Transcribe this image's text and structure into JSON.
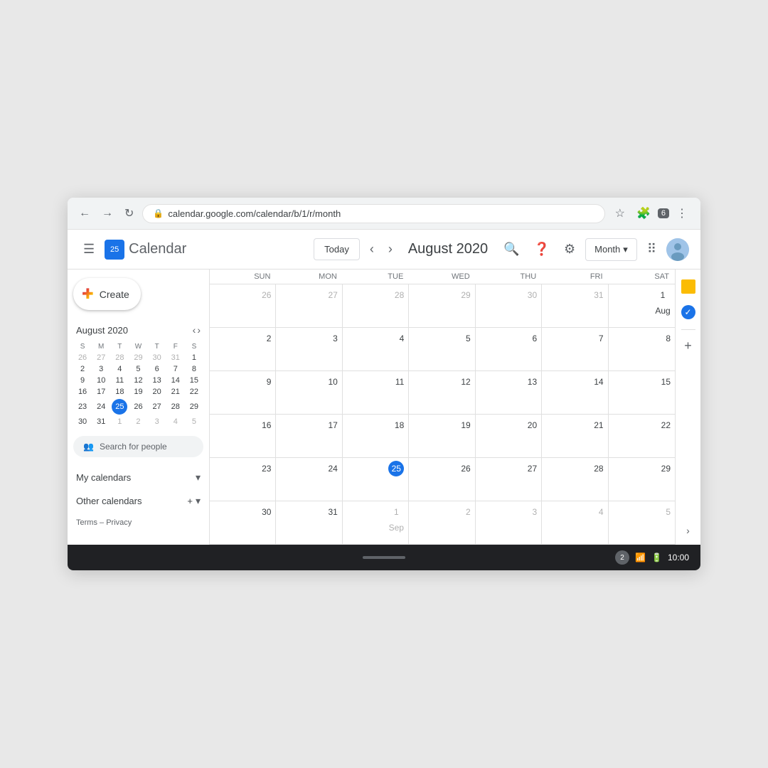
{
  "browser": {
    "url": "calendar.google.com/calendar/b/1/r/month",
    "tab_count": "6"
  },
  "header": {
    "logo_date": "25",
    "logo_text": "Calendar",
    "today_btn": "Today",
    "month_title": "August 2020",
    "view_label": "Month"
  },
  "sidebar": {
    "create_label": "Create",
    "mini_cal_title": "August 2020",
    "mini_cal_days": [
      "S",
      "M",
      "T",
      "W",
      "T",
      "F",
      "S"
    ],
    "mini_cal_rows": [
      [
        "26",
        "27",
        "28",
        "29",
        "30",
        "31",
        "1"
      ],
      [
        "2",
        "3",
        "4",
        "5",
        "6",
        "7",
        "8"
      ],
      [
        "9",
        "10",
        "11",
        "12",
        "13",
        "14",
        "15"
      ],
      [
        "16",
        "17",
        "18",
        "19",
        "20",
        "21",
        "22"
      ],
      [
        "23",
        "24",
        "25",
        "26",
        "27",
        "28",
        "29"
      ],
      [
        "30",
        "31",
        "1",
        "2",
        "3",
        "4",
        "5"
      ]
    ],
    "today_mini": "25",
    "search_people_placeholder": "Search for people",
    "my_calendars_label": "My calendars",
    "other_calendars_label": "Other calendars",
    "terms_label": "Terms",
    "privacy_label": "Privacy"
  },
  "calendar": {
    "weekdays": [
      "SUN",
      "MON",
      "TUE",
      "WED",
      "THU",
      "FRI",
      "SAT"
    ],
    "rows": [
      [
        {
          "day": "26",
          "type": "prev"
        },
        {
          "day": "27",
          "type": "prev"
        },
        {
          "day": "28",
          "type": "prev"
        },
        {
          "day": "29",
          "type": "prev"
        },
        {
          "day": "30",
          "type": "prev"
        },
        {
          "day": "31",
          "type": "prev"
        },
        {
          "day": "1 Aug",
          "type": "first"
        }
      ],
      [
        {
          "day": "2",
          "type": "cur"
        },
        {
          "day": "3",
          "type": "cur"
        },
        {
          "day": "4",
          "type": "cur"
        },
        {
          "day": "5",
          "type": "cur"
        },
        {
          "day": "6",
          "type": "cur"
        },
        {
          "day": "7",
          "type": "cur"
        },
        {
          "day": "8",
          "type": "cur"
        }
      ],
      [
        {
          "day": "9",
          "type": "cur"
        },
        {
          "day": "10",
          "type": "cur"
        },
        {
          "day": "11",
          "type": "cur"
        },
        {
          "day": "12",
          "type": "cur"
        },
        {
          "day": "13",
          "type": "cur"
        },
        {
          "day": "14",
          "type": "cur"
        },
        {
          "day": "15",
          "type": "cur"
        }
      ],
      [
        {
          "day": "16",
          "type": "cur"
        },
        {
          "day": "17",
          "type": "cur"
        },
        {
          "day": "18",
          "type": "cur"
        },
        {
          "day": "19",
          "type": "cur"
        },
        {
          "day": "20",
          "type": "cur"
        },
        {
          "day": "21",
          "type": "cur"
        },
        {
          "day": "22",
          "type": "cur"
        }
      ],
      [
        {
          "day": "23",
          "type": "cur"
        },
        {
          "day": "24",
          "type": "cur"
        },
        {
          "day": "25",
          "type": "today"
        },
        {
          "day": "26",
          "type": "cur"
        },
        {
          "day": "27",
          "type": "cur"
        },
        {
          "day": "28",
          "type": "cur"
        },
        {
          "day": "29",
          "type": "cur"
        }
      ],
      [
        {
          "day": "30",
          "type": "cur"
        },
        {
          "day": "31",
          "type": "cur"
        },
        {
          "day": "1 Sep",
          "type": "next"
        },
        {
          "day": "2",
          "type": "next"
        },
        {
          "day": "3",
          "type": "next"
        },
        {
          "day": "4",
          "type": "next"
        },
        {
          "day": "5",
          "type": "next"
        }
      ]
    ]
  },
  "status_bar": {
    "notification_count": "2",
    "time": "10:00"
  }
}
